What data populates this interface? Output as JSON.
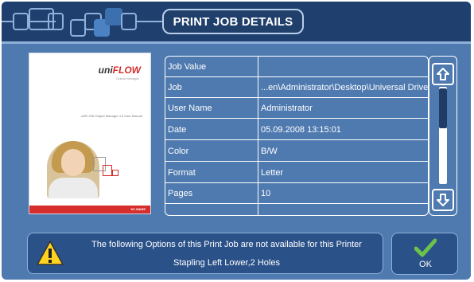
{
  "window": {
    "title": "PRINT JOB DETAILS"
  },
  "preview": {
    "logo_prefix": "uni",
    "logo_brand": "FLOW",
    "logo_sub": "Output Manager",
    "doc_title": "uniFLOW Output Manager 4.0 User Manual",
    "footer_brand": "NT-WARE"
  },
  "table": {
    "rows": [
      {
        "key": "Job Value",
        "value": ""
      },
      {
        "key": "Job",
        "value": "...en\\Administrator\\Desktop\\Universal Drive"
      },
      {
        "key": "User Name",
        "value": "Administrator"
      },
      {
        "key": "Date",
        "value": "05.09.2008 13:15:01"
      },
      {
        "key": "Color",
        "value": "B/W"
      },
      {
        "key": "Format",
        "value": "Letter"
      },
      {
        "key": "Pages",
        "value": "10"
      }
    ]
  },
  "scroll": {
    "up_icon": "arrow-up-icon",
    "down_icon": "arrow-down-icon",
    "position": 0.15
  },
  "message": {
    "line1": "The following Options of this Print Job are not available for this Printer",
    "line2": "Stapling Left Lower,2 Holes",
    "icon": "warning-icon"
  },
  "ok_button": {
    "label": "OK",
    "icon": "checkmark-icon"
  },
  "colors": {
    "panel": "#4f7ab0",
    "topbar": "#1f3f6e",
    "accent_green": "#6cc24a",
    "brand_red": "#d62d2d"
  }
}
